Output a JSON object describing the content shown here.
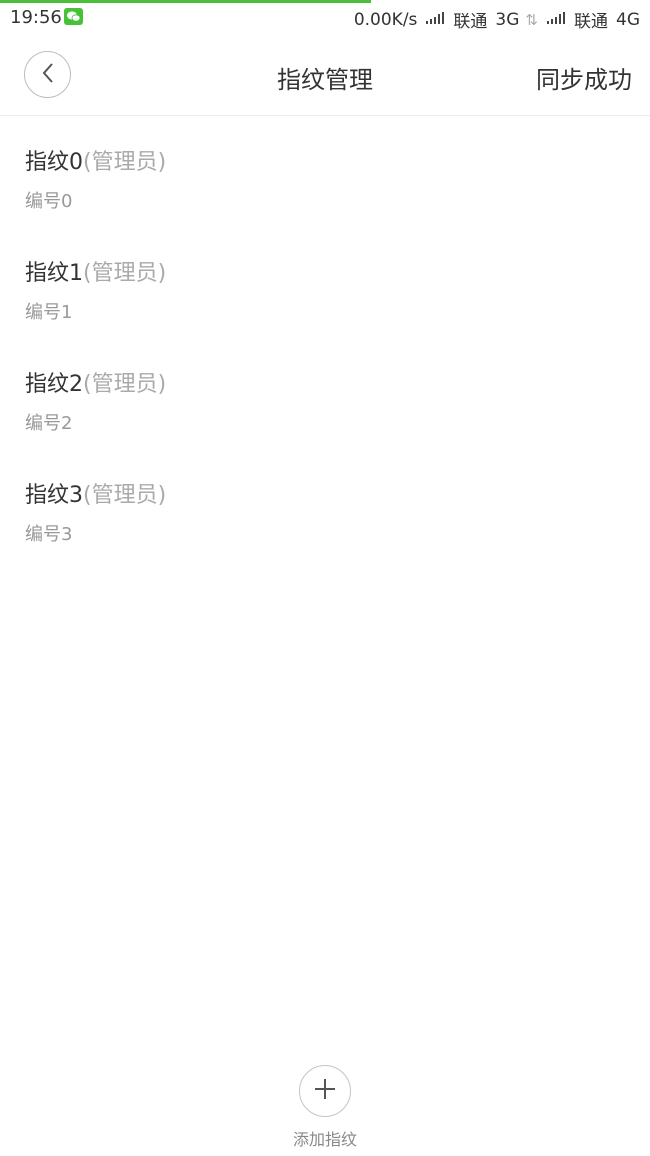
{
  "status_bar": {
    "time": "19:56",
    "network_speed": "0.00K/s",
    "carrier1": "联通",
    "net_type1": "3G",
    "carrier2": "联通",
    "net_type2": "4G",
    "app_icon": "wechat-icon",
    "signal_icon": "signal-icon"
  },
  "progress": {
    "fraction": 0.57,
    "color": "#4cbf3a"
  },
  "nav": {
    "back_icon": "chevron-left-icon",
    "title": "指纹管理",
    "sync_status": "同步成功"
  },
  "fingerprints": [
    {
      "name": "指纹0",
      "role": "(管理员)",
      "number": "编号0"
    },
    {
      "name": "指纹1",
      "role": "(管理员)",
      "number": "编号1"
    },
    {
      "name": "指纹2",
      "role": "(管理员)",
      "number": "编号2"
    },
    {
      "name": "指纹3",
      "role": "(管理员)",
      "number": "编号3"
    }
  ],
  "add_fingerprint": {
    "icon": "plus-icon",
    "label": "添加指纹"
  }
}
